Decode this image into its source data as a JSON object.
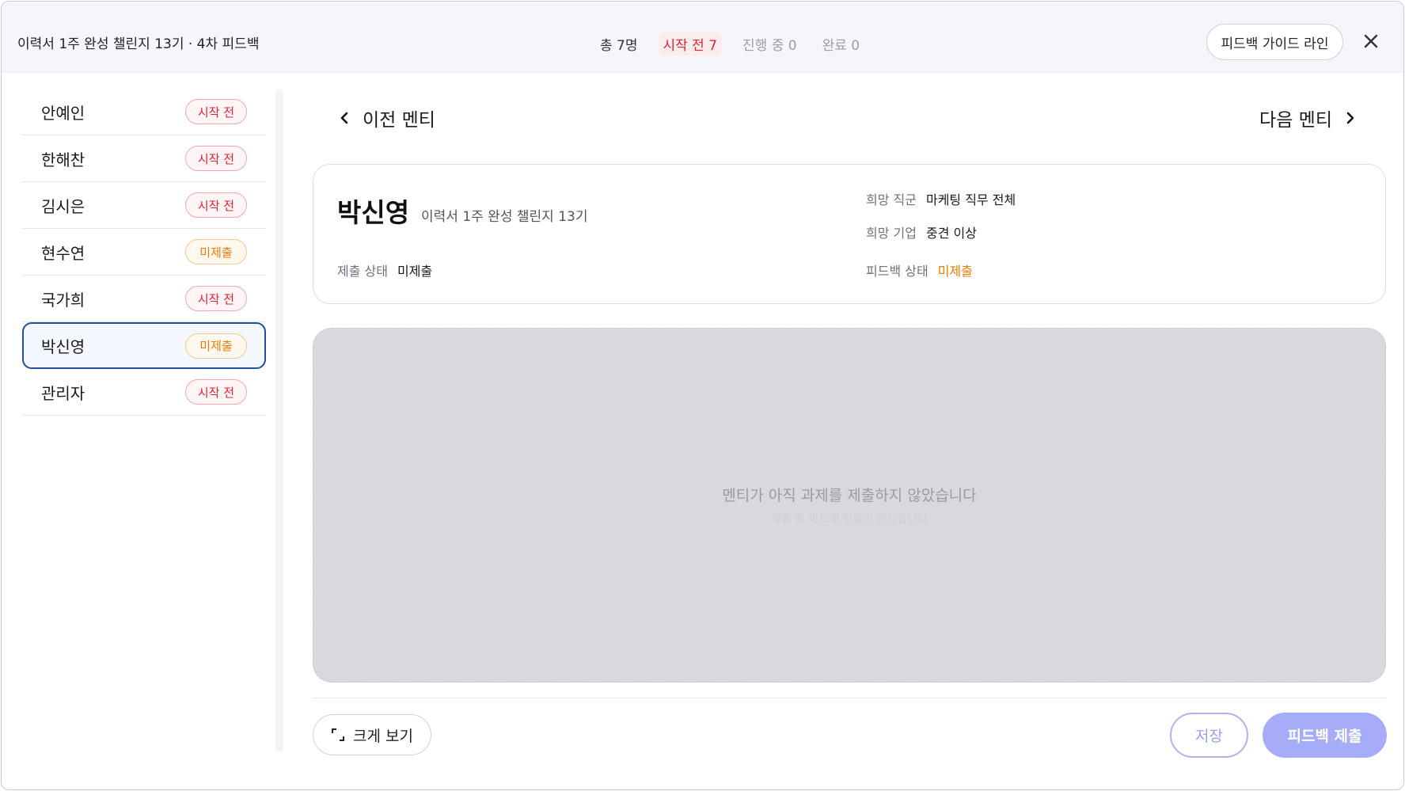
{
  "header": {
    "title": "이력서 1주 완성 챌린지 13기 · 4차 피드백",
    "stats": {
      "total": "총 7명",
      "not_started": "시작 전 7",
      "in_progress": "진행 중 0",
      "completed": "완료 0"
    },
    "guide_button": "피드백 가이드 라인",
    "close_icon": "close-icon"
  },
  "sidebar": {
    "items": [
      {
        "name": "안예인",
        "status": "시작 전",
        "status_type": "not-started"
      },
      {
        "name": "한해찬",
        "status": "시작 전",
        "status_type": "not-started"
      },
      {
        "name": "김시은",
        "status": "시작 전",
        "status_type": "not-started"
      },
      {
        "name": "현수연",
        "status": "미제출",
        "status_type": "not-submitted"
      },
      {
        "name": "국가희",
        "status": "시작 전",
        "status_type": "not-started"
      },
      {
        "name": "박신영",
        "status": "미제출",
        "status_type": "not-submitted",
        "selected": true
      },
      {
        "name": "관리자",
        "status": "시작 전",
        "status_type": "not-started"
      }
    ]
  },
  "nav": {
    "prev": "이전 멘티",
    "next": "다음 멘티"
  },
  "mentee": {
    "name": "박신영",
    "course": "이력서 1주 완성 챌린지 13기",
    "submit_status_label": "제출 상태",
    "submit_status_value": "미제출",
    "desired_job_label": "희망 직군",
    "desired_job_value": "마케팅 직무 전체",
    "desired_company_label": "희망 기업",
    "desired_company_value": "중견 이상",
    "feedback_status_label": "피드백 상태",
    "feedback_status_value": "미제출"
  },
  "content": {
    "empty_message": "멘티가 아직 과제를 제출하지 않았습니다",
    "empty_sub": "제출 후 피드백 작성이 가능합니다"
  },
  "footer": {
    "expand_button": "크게 보기",
    "save_button": "저장",
    "submit_button": "피드백 제출"
  },
  "colors": {
    "accent": "#a6acf7",
    "status_red": "#e0242f",
    "status_orange": "#ef7b00",
    "selected_border": "#1d4f9a"
  }
}
